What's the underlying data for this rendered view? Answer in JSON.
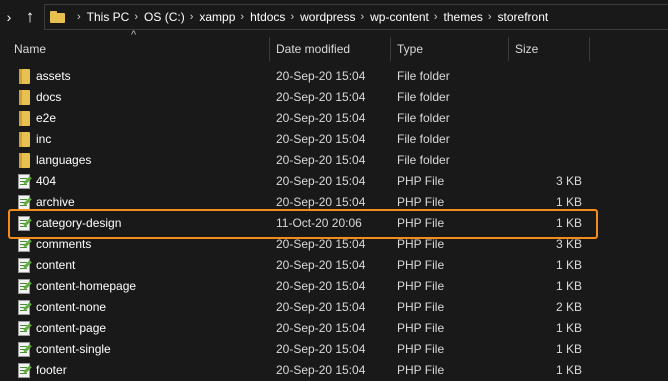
{
  "breadcrumb": {
    "items": [
      "This PC",
      "OS (C:)",
      "xampp",
      "htdocs",
      "wordpress",
      "wp-content",
      "themes",
      "storefront"
    ]
  },
  "columns": {
    "name": "Name",
    "date_modified": "Date modified",
    "type": "Type",
    "size": "Size"
  },
  "sort": {
    "column": "Name",
    "indicator": "^"
  },
  "files": [
    {
      "name": "assets",
      "date": "20-Sep-20 15:04",
      "type": "File folder",
      "size": "",
      "icon": "folder-icon"
    },
    {
      "name": "docs",
      "date": "20-Sep-20 15:04",
      "type": "File folder",
      "size": "",
      "icon": "folder-icon"
    },
    {
      "name": "e2e",
      "date": "20-Sep-20 15:04",
      "type": "File folder",
      "size": "",
      "icon": "folder-icon"
    },
    {
      "name": "inc",
      "date": "20-Sep-20 15:04",
      "type": "File folder",
      "size": "",
      "icon": "folder-icon"
    },
    {
      "name": "languages",
      "date": "20-Sep-20 15:04",
      "type": "File folder",
      "size": "",
      "icon": "folder-icon"
    },
    {
      "name": "404",
      "date": "20-Sep-20 15:04",
      "type": "PHP File",
      "size": "3 KB",
      "icon": "php-file-icon"
    },
    {
      "name": "archive",
      "date": "20-Sep-20 15:04",
      "type": "PHP File",
      "size": "1 KB",
      "icon": "php-file-icon"
    },
    {
      "name": "category-design",
      "date": "11-Oct-20 20:06",
      "type": "PHP File",
      "size": "1 KB",
      "icon": "php-file-icon",
      "highlighted": true
    },
    {
      "name": "comments",
      "date": "20-Sep-20 15:04",
      "type": "PHP File",
      "size": "3 KB",
      "icon": "php-file-icon"
    },
    {
      "name": "content",
      "date": "20-Sep-20 15:04",
      "type": "PHP File",
      "size": "1 KB",
      "icon": "php-file-icon"
    },
    {
      "name": "content-homepage",
      "date": "20-Sep-20 15:04",
      "type": "PHP File",
      "size": "1 KB",
      "icon": "php-file-icon"
    },
    {
      "name": "content-none",
      "date": "20-Sep-20 15:04",
      "type": "PHP File",
      "size": "2 KB",
      "icon": "php-file-icon"
    },
    {
      "name": "content-page",
      "date": "20-Sep-20 15:04",
      "type": "PHP File",
      "size": "1 KB",
      "icon": "php-file-icon"
    },
    {
      "name": "content-single",
      "date": "20-Sep-20 15:04",
      "type": "PHP File",
      "size": "1 KB",
      "icon": "php-file-icon"
    },
    {
      "name": "footer",
      "date": "20-Sep-20 15:04",
      "type": "PHP File",
      "size": "1 KB",
      "icon": "php-file-icon"
    }
  ],
  "colors": {
    "background": "#191919",
    "folder": "#e7c04f",
    "highlight_border": "#f28c1a"
  }
}
